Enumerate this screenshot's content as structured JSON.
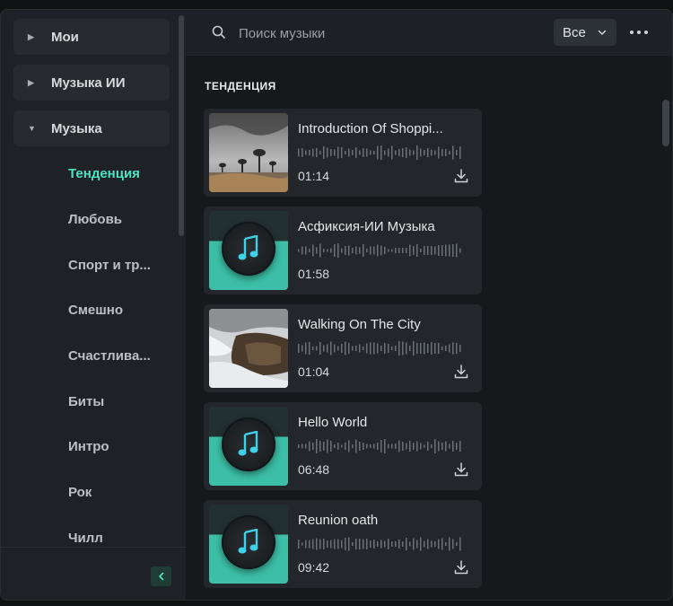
{
  "sidebar": {
    "groups": [
      {
        "label": "Мои",
        "expanded": false
      },
      {
        "label": "Музыка ИИ",
        "expanded": false
      },
      {
        "label": "Музыка",
        "expanded": true
      }
    ],
    "subitems": [
      {
        "label": "Тенденция",
        "active": true
      },
      {
        "label": "Любовь",
        "active": false
      },
      {
        "label": "Спорт и тр...",
        "active": false
      },
      {
        "label": "Смешно",
        "active": false
      },
      {
        "label": "Счастлива...",
        "active": false
      },
      {
        "label": "Биты",
        "active": false
      },
      {
        "label": "Интро",
        "active": false
      },
      {
        "label": "Рок",
        "active": false
      },
      {
        "label": "Чилл",
        "active": false
      }
    ],
    "collapse_icon": "chevron-left-icon"
  },
  "search": {
    "placeholder": "Поиск музыки",
    "value": ""
  },
  "filter": {
    "selected": "Все"
  },
  "section": {
    "title": "ТЕНДЕНЦИЯ"
  },
  "tracks": [
    {
      "title": "Introduction Of Shoppi...",
      "duration": "01:14",
      "thumb": "landscape-trees"
    },
    {
      "title": "Асфиксия-ИИ Музыка",
      "duration": "01:58",
      "thumb": "music-disc"
    },
    {
      "title": "Walking On The City",
      "duration": "01:04",
      "thumb": "rocky-coast"
    },
    {
      "title": "Hello World",
      "duration": "06:48",
      "thumb": "music-disc"
    },
    {
      "title": "Reunion oath",
      "duration": "09:42",
      "thumb": "music-disc"
    }
  ],
  "colors": {
    "accent": "#4fe3c1",
    "thumb_teal": "#3cbfa6"
  }
}
